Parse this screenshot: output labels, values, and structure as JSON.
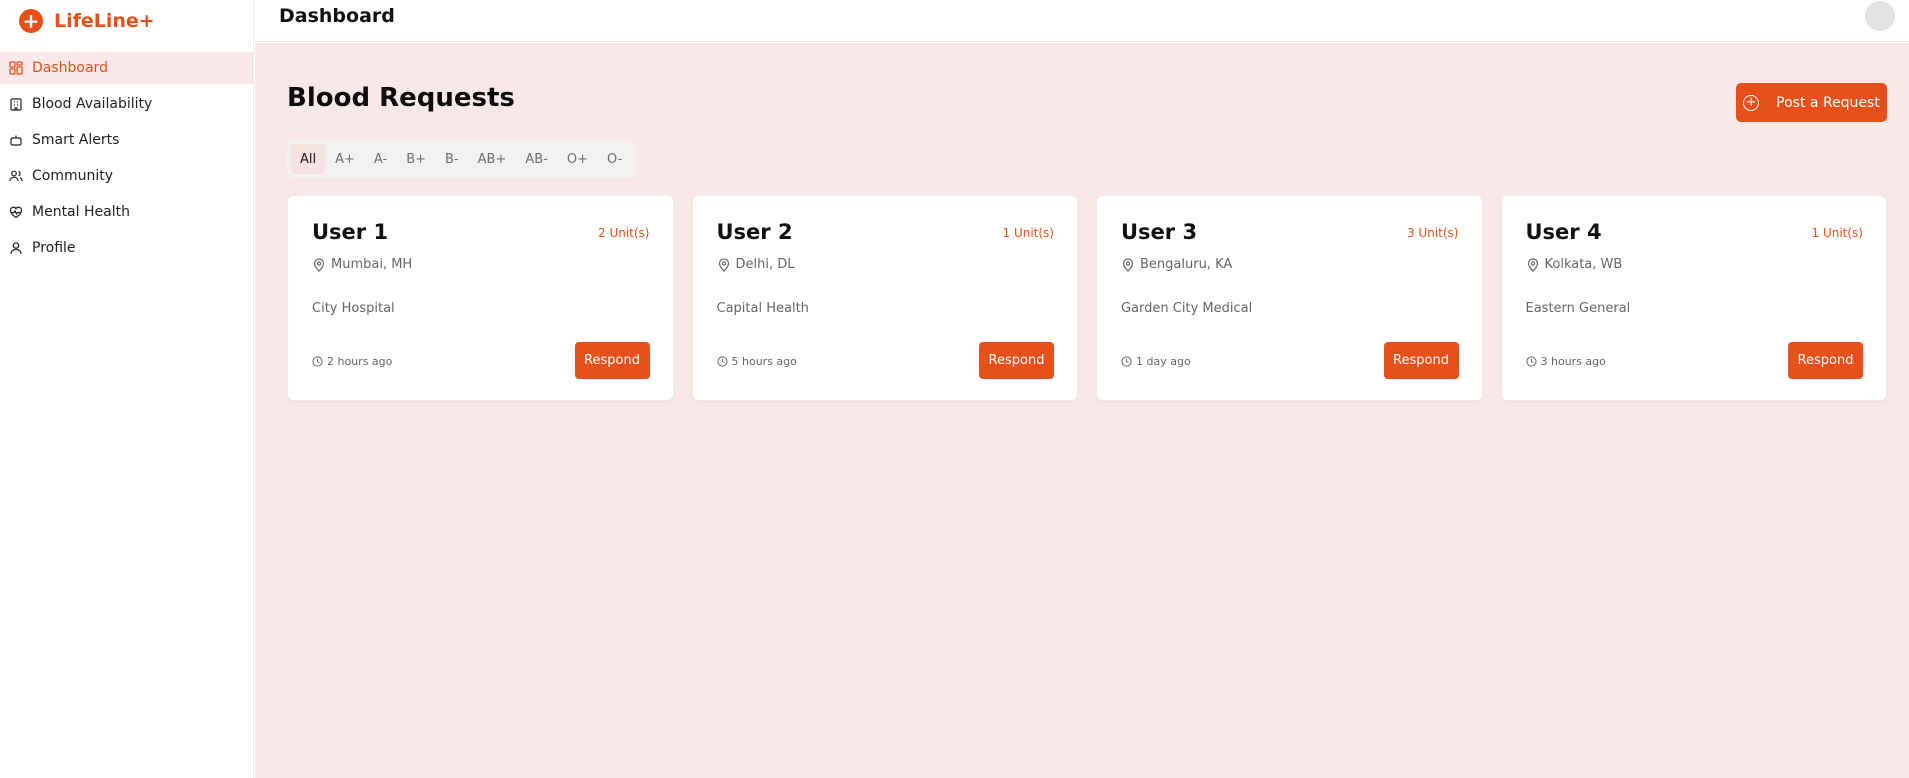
{
  "app": {
    "name": "LifeLine+",
    "logo_glyph": "+"
  },
  "colors": {
    "accent": "#e8501b",
    "main_bg": "#f8e8e7",
    "active_nav_bg": "#f9e9e8"
  },
  "sidebar": {
    "items": [
      {
        "label": "Dashboard",
        "icon": "grid-icon",
        "active": true
      },
      {
        "label": "Blood Availability",
        "icon": "building-icon"
      },
      {
        "label": "Smart Alerts",
        "icon": "robot-icon"
      },
      {
        "label": "Community",
        "icon": "users-icon"
      },
      {
        "label": "Mental Health",
        "icon": "heart-pulse-icon"
      },
      {
        "label": "Profile",
        "icon": "user-icon"
      }
    ]
  },
  "header": {
    "title": "Dashboard"
  },
  "main": {
    "title": "Blood Requests",
    "post_button": {
      "label": "Post a Request",
      "icon": "plus-circle-icon"
    },
    "filters": [
      "All",
      "A+",
      "A-",
      "B+",
      "B-",
      "AB+",
      "AB-",
      "O+",
      "O-"
    ],
    "active_filter": "All",
    "requests": [
      {
        "name": "User 1",
        "units": "2 Unit(s)",
        "location": "Mumbai, MH",
        "hospital": "City Hospital",
        "time": "2 hours ago",
        "action": "Respond"
      },
      {
        "name": "User 2",
        "units": "1 Unit(s)",
        "location": "Delhi, DL",
        "hospital": "Capital Health",
        "time": "5 hours ago",
        "action": "Respond"
      },
      {
        "name": "User 3",
        "units": "3 Unit(s)",
        "location": "Bengaluru, KA",
        "hospital": "Garden City Medical",
        "time": "1 day ago",
        "action": "Respond"
      },
      {
        "name": "User 4",
        "units": "1 Unit(s)",
        "location": "Kolkata, WB",
        "hospital": "Eastern General",
        "time": "3 hours ago",
        "action": "Respond"
      }
    ]
  }
}
